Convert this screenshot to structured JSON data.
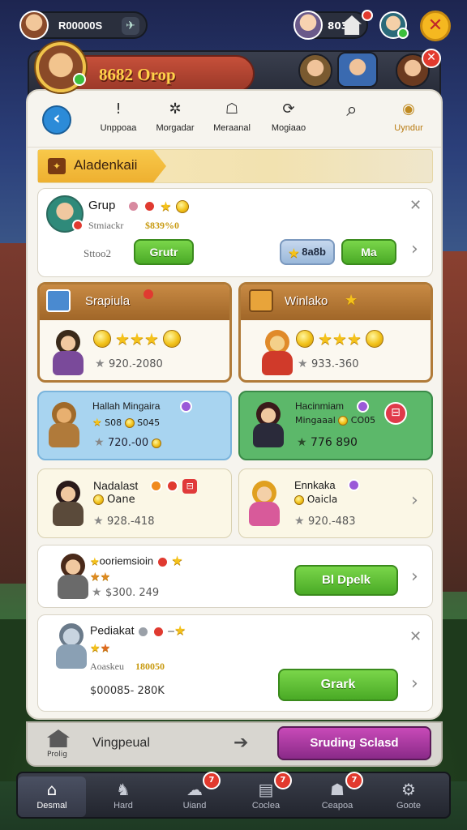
{
  "topbar": {
    "player_name": "R00000S",
    "coin_value": "803",
    "home_badge": ""
  },
  "group": {
    "title": "8682 Orop"
  },
  "nav": {
    "items": [
      {
        "label": "Unppoaa",
        "icon": "!"
      },
      {
        "label": "Morgadar",
        "icon": "✲"
      },
      {
        "label": "Meraanal",
        "icon": "☖"
      },
      {
        "label": "Mogiaao",
        "icon": "⟳"
      },
      {
        "label": "",
        "icon": "⌕"
      },
      {
        "label": "Uyndur",
        "icon": "◉"
      }
    ]
  },
  "section": {
    "title": "Aladenkaii"
  },
  "card1": {
    "title": "Grup",
    "sub_label": "Stmiackr",
    "sub_value": "$839%0",
    "left_label": "Sttoo2",
    "primary_button": "Grutr",
    "secondary_button": "8a8b",
    "third_button": "Ma"
  },
  "tiles": [
    {
      "title": "Srapiula",
      "price": "920.-2080"
    },
    {
      "title": "Winlako",
      "price": "933.-360"
    },
    {
      "title": "Hallah Mingaira",
      "sub": "S08",
      "sub2": "S045",
      "price": "720.-00"
    },
    {
      "title": "Hacinmiam",
      "sub": "Mingaaal",
      "sub2": "CO05",
      "price": "776 890"
    },
    {
      "title": "Nadalast",
      "sub": "Oane",
      "price": "928.-418"
    },
    {
      "title": "Ennkaka",
      "sub": "Oaicla",
      "price": "920.-483"
    }
  ],
  "row1": {
    "title": "ooriemsioin",
    "price": "$300. 249",
    "button": "Bl Dpelk"
  },
  "row2": {
    "title": "Pediakat",
    "sub_label": "Aoaskeu",
    "sub_value": "180050",
    "price": "$00085- 280K",
    "button": "Grark"
  },
  "actionbar": {
    "home_label": "Prolig",
    "label": "Vingpeual",
    "button": "Sruding Sclasd"
  },
  "tabs": [
    {
      "label": "Desmal",
      "badge": ""
    },
    {
      "label": "Hard",
      "badge": ""
    },
    {
      "label": "Uiand",
      "badge": "7"
    },
    {
      "label": "Coclea",
      "badge": "7"
    },
    {
      "label": "Ceapoa",
      "badge": "7"
    },
    {
      "label": "Goote",
      "badge": ""
    }
  ],
  "colors": {
    "accent_gold": "#f5b820",
    "button_green": "#4aaa26",
    "button_purple": "#8a2a88",
    "tile_blue": "#a8d4f0",
    "tile_green": "#5cb86a",
    "badge_red": "#e23a2e"
  }
}
